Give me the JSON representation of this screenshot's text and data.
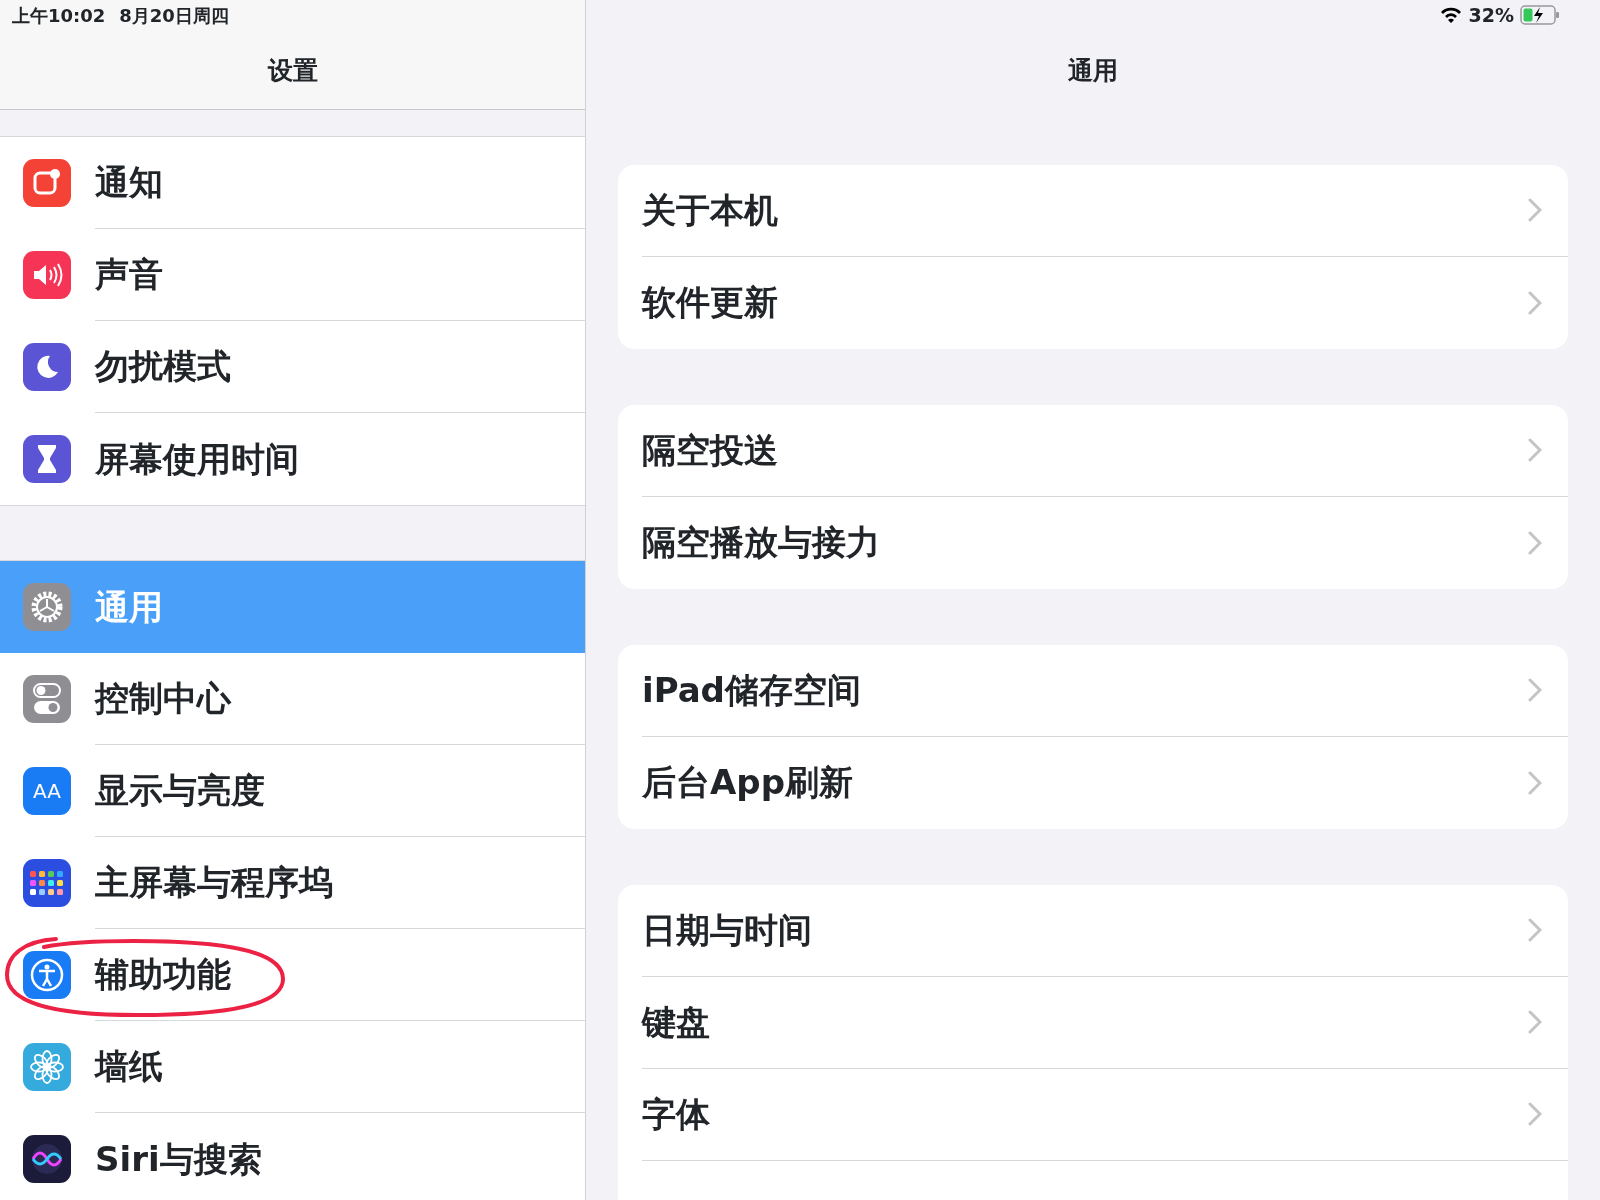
{
  "status_bar": {
    "time": "上午10:02",
    "date": "8月20日周四",
    "battery_text": "32%"
  },
  "sidebar": {
    "title": "设置",
    "groups": [
      {
        "items": [
          {
            "label": "通知",
            "kind": "notice",
            "color": "#f44336",
            "selected": false
          },
          {
            "label": "声音",
            "kind": "speaker",
            "color": "#f63456",
            "selected": false
          },
          {
            "label": "勿扰模式",
            "kind": "moon",
            "color": "#5b55d6",
            "selected": false
          },
          {
            "label": "屏幕使用时间",
            "kind": "hourglass",
            "color": "#5b55d6",
            "selected": false
          }
        ]
      },
      {
        "items": [
          {
            "label": "通用",
            "kind": "gear",
            "color": "#8e8e93",
            "selected": true
          },
          {
            "label": "控制中心",
            "kind": "toggles",
            "color": "#8e8e93",
            "selected": false
          },
          {
            "label": "显示与亮度",
            "kind": "text",
            "icon_text": "AA",
            "color": "#1a7cf5",
            "selected": false
          },
          {
            "label": "主屏幕与程序坞",
            "kind": "grid",
            "color": "#2c4ee0",
            "selected": false
          },
          {
            "label": "辅助功能",
            "kind": "accessibility",
            "color": "#1a7cf5",
            "selected": false,
            "annotated": true
          },
          {
            "label": "墙纸",
            "kind": "flower",
            "color": "#35aadc",
            "selected": false
          },
          {
            "label": "Siri与搜索",
            "kind": "siri",
            "color": "#1c1c3a",
            "selected": false
          }
        ]
      }
    ]
  },
  "detail": {
    "title": "通用",
    "groups": [
      {
        "items": [
          "关于本机",
          "软件更新"
        ]
      },
      {
        "items": [
          "隔空投送",
          "隔空播放与接力"
        ]
      },
      {
        "items": [
          "iPad储存空间",
          "后台App刷新"
        ]
      },
      {
        "items": [
          "日期与时间",
          "键盘",
          "字体"
        ]
      }
    ]
  }
}
